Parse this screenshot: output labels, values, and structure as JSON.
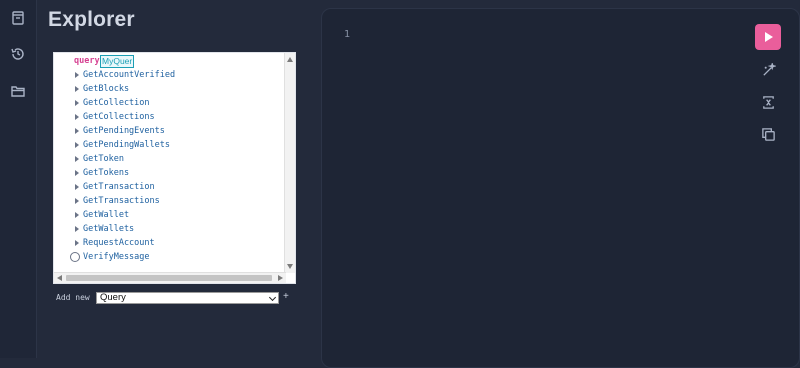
{
  "sidebar": {
    "icons": [
      "docs-icon",
      "history-icon",
      "folder-icon"
    ]
  },
  "explorer": {
    "title": "Explorer",
    "keyword": "query",
    "operation_name": "MyQuer",
    "fields": [
      "GetAccountVerified",
      "GetBlocks",
      "GetCollection",
      "GetCollections",
      "GetPendingEvents",
      "GetPendingWallets",
      "GetToken",
      "GetTokens",
      "GetTransaction",
      "GetTransactions",
      "GetWallet",
      "GetWallets",
      "RequestAccount"
    ],
    "last_field": "VerifyMessage",
    "add_new_label": "Add new",
    "operation_type": "Query",
    "add_plus": "+"
  },
  "editor": {
    "line_number": "1"
  },
  "colors": {
    "background": "#232a3b",
    "run_button": "#ea5e9b",
    "field_text": "#1f61a0",
    "keyword": "#d64292"
  }
}
